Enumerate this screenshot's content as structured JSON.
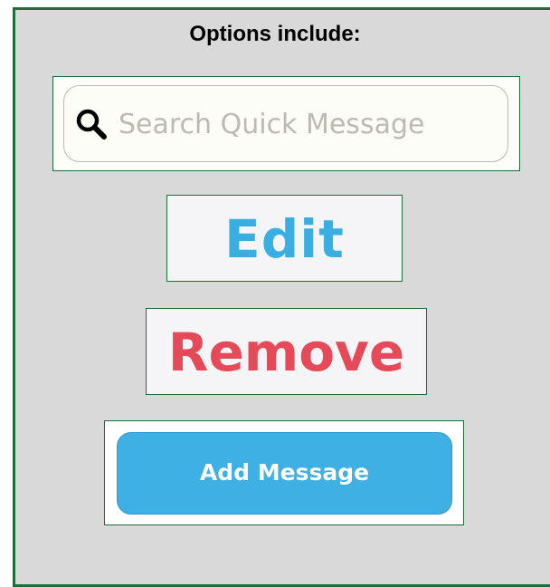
{
  "heading": "Options include:",
  "search": {
    "placeholder": "Search Quick Message",
    "value": "",
    "icon": "search-icon"
  },
  "actions": {
    "edit_label": "Edit",
    "remove_label": "Remove",
    "add_label": "Add Message"
  },
  "colors": {
    "panel_border": "#1f6b3a",
    "panel_background": "#d9d9d9",
    "edit": "#39aee0",
    "remove": "#e64a59",
    "add_button": "#3eb0e4"
  }
}
